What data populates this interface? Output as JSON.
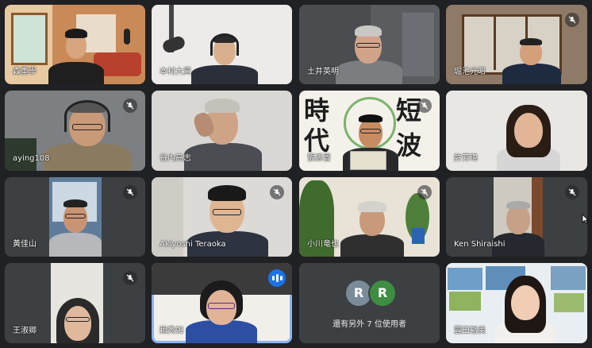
{
  "participants": [
    {
      "name": "森重學",
      "muted": false
    },
    {
      "name": "本村大資",
      "muted": false
    },
    {
      "name": "土井英明",
      "muted": false
    },
    {
      "name": "堀池光昭",
      "muted": true
    },
    {
      "name": "aying108",
      "muted": true
    },
    {
      "name": "谷內高志",
      "muted": false
    },
    {
      "name": "張孫冒",
      "muted": true
    },
    {
      "name": "許芳瑋",
      "muted": false
    },
    {
      "name": "黃佳山",
      "muted": true
    },
    {
      "name": "Akiyoshi Teraoka",
      "muted": true
    },
    {
      "name": "小川竜也",
      "muted": true
    },
    {
      "name": "Ken Shiraishi",
      "muted": true
    },
    {
      "name": "王淑卿",
      "muted": true
    },
    {
      "name": "賴秀如",
      "muted": false,
      "speaking": true
    },
    {
      "name": "豐田裕美",
      "muted": false
    }
  ],
  "others": {
    "label": "還有另外 7 位使用者",
    "avatars": [
      {
        "initial": "R",
        "color": "#7a8b99"
      },
      {
        "initial": "R",
        "color": "#3e8e41"
      }
    ]
  },
  "book_cover": {
    "chars": [
      "時",
      "代",
      "短",
      "波"
    ]
  },
  "colors": {
    "background": "#202124",
    "tile": "#3c4043",
    "accent": "#1a73e8"
  }
}
